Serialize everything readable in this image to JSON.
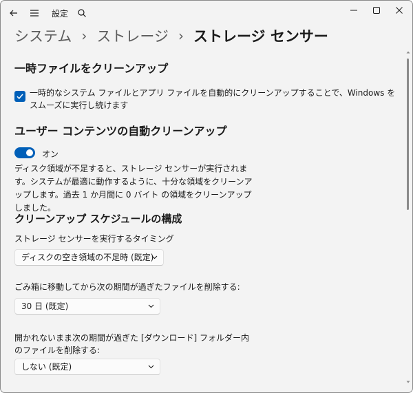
{
  "titlebar": {
    "app_title": "設定",
    "icons": [
      "back-arrow-icon",
      "hamburger-menu-icon",
      "search-icon",
      "minimize-icon",
      "maximize-icon",
      "close-icon"
    ]
  },
  "breadcrumb": {
    "items": [
      "システム",
      "ストレージ",
      "ストレージ センサー"
    ],
    "separator": "›"
  },
  "temp_files": {
    "heading": "一時ファイルをクリーンアップ",
    "checkbox_label": "一時的なシステム ファイルとアプリ ファイルを自動的にクリーンアップすることで、Windows をスムーズに実行し続けます",
    "checkbox_checked": true
  },
  "auto_cleanup": {
    "heading": "ユーザー コンテンツの自動クリーンアップ",
    "toggle_state": "オン",
    "toggle_on": true,
    "description": "ディスク領域が不足すると、ストレージ センサーが実行されます。システムが最適に動作するように、十分な領域をクリーンアップします。過去 1 か月間に 0 バイト の領域をクリーンアップしました。"
  },
  "schedule": {
    "heading": "クリーンアップ スケジュールの構成",
    "run_timing": {
      "label": "ストレージ センサーを実行するタイミング",
      "value": "ディスクの空き領域の不足時 (既定)"
    },
    "recycle_bin": {
      "label": "ごみ箱に移動してから次の期間が過ぎたファイルを削除する:",
      "value": "30 日 (既定)"
    },
    "downloads": {
      "label": "開かれないまま次の期間が過ぎた [ダウンロード] フォルダー内のファイルを削除する:",
      "value": "しない (既定)"
    }
  },
  "colors": {
    "accent": "#005fb8",
    "background": "#f3f3f3",
    "text": "#1b1b1b"
  }
}
